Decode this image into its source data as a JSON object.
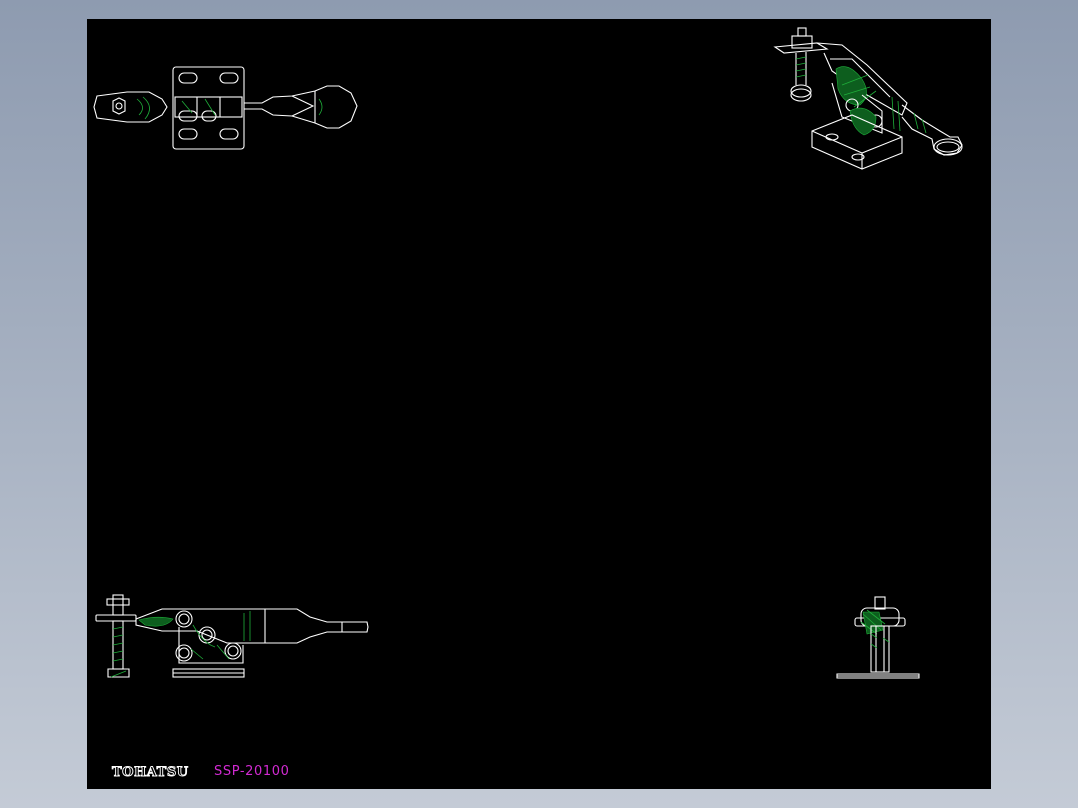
{
  "drawing": {
    "background_color": "#000000",
    "line_color": "#ffffff",
    "hatch_color": "#1fae3a",
    "partno_color": "#d22ad2",
    "brand": "TOHATSU",
    "part_number": "SSP-20100"
  },
  "views": [
    {
      "name": "top-view"
    },
    {
      "name": "isometric-view"
    },
    {
      "name": "front-view"
    },
    {
      "name": "side-view"
    }
  ]
}
